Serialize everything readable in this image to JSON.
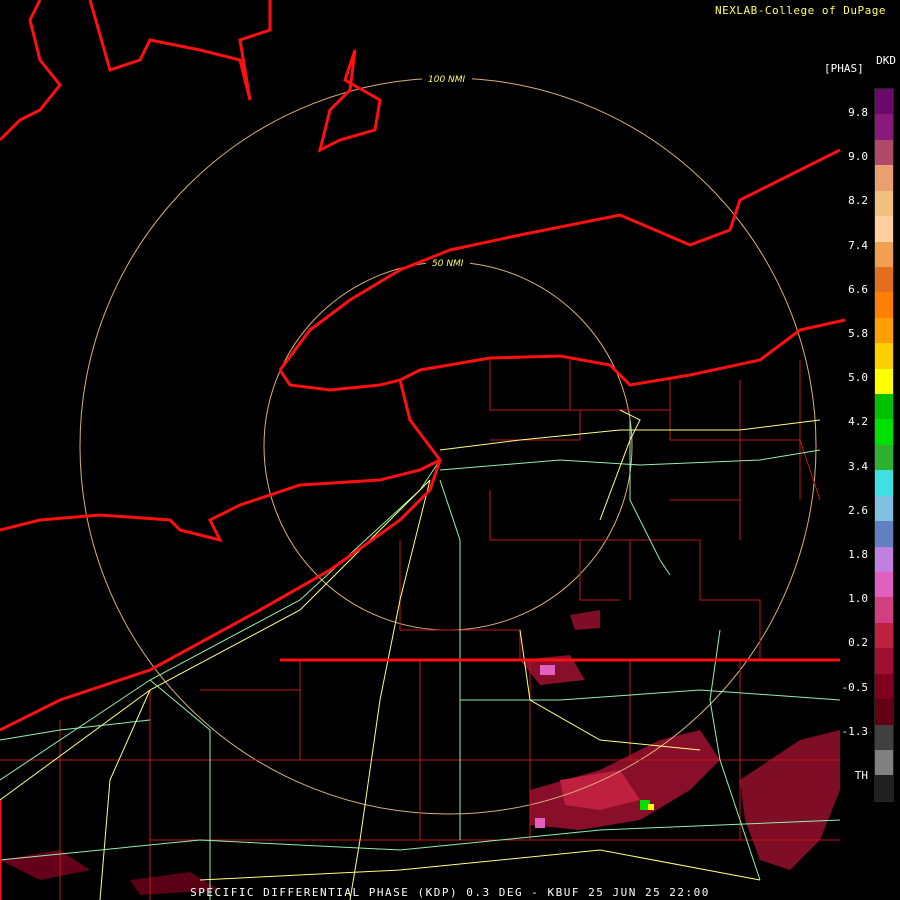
{
  "header": {
    "credit": "NEXLAB-College of DuPage",
    "product_code": "DKD",
    "units": "[PHAS]"
  },
  "rings": [
    {
      "label": "100 NMI",
      "color": "#d9b07a"
    },
    {
      "label": "50 NMI",
      "color": "#d9b07a"
    }
  ],
  "scale": {
    "labels": [
      "9.8",
      "9.0",
      "8.2",
      "7.4",
      "6.6",
      "5.8",
      "5.0",
      "4.2",
      "3.4",
      "2.6",
      "1.8",
      "1.0",
      "0.2",
      "-0.5",
      "-1.3",
      "TH"
    ],
    "colors": [
      "#6a0a6a",
      "#8a1a7a",
      "#b04a6a",
      "#e8a070",
      "#f0c080",
      "#ffd0a0",
      "#f0a050",
      "#e07020",
      "#ff8000",
      "#ffa000",
      "#ffd000",
      "#ffff00",
      "#00c000",
      "#00e000",
      "#30b030",
      "#40e0e0",
      "#80c0e0",
      "#6080c0",
      "#c080e0",
      "#e060c0",
      "#d04080",
      "#c02040",
      "#a01030",
      "#800020",
      "#600010",
      "#404040",
      "#808080",
      "#202020"
    ]
  },
  "footer": {
    "text": "SPECIFIC DIFFERENTIAL PHASE (KDP) 0.3 DEG - KBUF 25 JUN 25 22:00"
  },
  "colors": {
    "coast": "#ff1010",
    "county": "#c01818",
    "highway": "#ffff80",
    "road": "#90f0b0"
  }
}
